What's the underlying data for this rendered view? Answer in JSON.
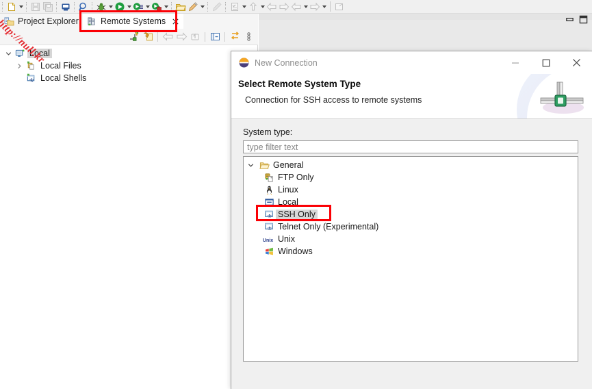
{
  "app_toolbar": {
    "items": [
      {
        "name": "new-file-button",
        "icon": "new-document-icon",
        "has_dropdown": true
      },
      {
        "name": "save-button",
        "icon": "save-icon",
        "has_dropdown": false
      },
      {
        "name": "save-all-button",
        "icon": "save-all-icon",
        "has_dropdown": false
      },
      {
        "name": "print-button",
        "icon": "print-icon",
        "has_dropdown": false
      },
      {
        "name": "search-button",
        "icon": "search-icon",
        "has_dropdown": false
      },
      {
        "name": "debug-button",
        "icon": "debug-bug-icon",
        "has_dropdown": true
      },
      {
        "name": "run-button",
        "icon": "run-play-icon",
        "has_dropdown": true
      },
      {
        "name": "run-external-tools-button",
        "icon": "external-tools-icon",
        "has_dropdown": true
      },
      {
        "name": "profile-button",
        "icon": "profile-icon",
        "has_dropdown": true
      },
      {
        "name": "open-resource-button",
        "icon": "open-folder-icon",
        "has_dropdown": false
      },
      {
        "name": "pencil-button",
        "icon": "pencil-icon",
        "has_dropdown": true
      },
      {
        "name": "edit-button",
        "icon": "grey-pencil-icon",
        "has_dropdown": false
      },
      {
        "name": "task-button",
        "icon": "checklist-icon",
        "has_dropdown": true
      },
      {
        "name": "next-annotation-button",
        "icon": "up-arrow-icon",
        "has_dropdown": true
      },
      {
        "name": "back-button",
        "icon": "back-arrow-icon",
        "has_dropdown": false
      },
      {
        "name": "forward-button",
        "icon": "forward-arrow-icon",
        "has_dropdown": false
      },
      {
        "name": "previous-edit-button",
        "icon": "left-arrow-icon",
        "has_dropdown": true
      },
      {
        "name": "next-edit-button",
        "icon": "right-arrow-icon",
        "has_dropdown": true
      },
      {
        "name": "new-window-button",
        "icon": "new-window-icon",
        "has_dropdown": false
      }
    ]
  },
  "tabs": [
    {
      "label": "Project Explorer",
      "icon": "project-explorer-icon",
      "active": false,
      "closable": false
    },
    {
      "label": "Remote Systems",
      "icon": "remote-systems-icon",
      "active": true,
      "closable": true
    }
  ],
  "view_window_buttons": [
    {
      "name": "minimize-view-button",
      "icon": "minimize-icon"
    },
    {
      "name": "maximize-view-button",
      "icon": "maximize-icon"
    }
  ],
  "view_toolbar": {
    "items": [
      {
        "name": "new-connection-toolbar-button",
        "icon": "new-connection-icon"
      },
      {
        "name": "refresh-button",
        "icon": "refresh-icon"
      },
      {
        "name": "back-nav-button",
        "icon": "back-arrow-icon"
      },
      {
        "name": "forward-nav-button",
        "icon": "forward-arrow-icon"
      },
      {
        "name": "go-up-button",
        "icon": "go-up-icon"
      },
      {
        "name": "collapse-all-button",
        "icon": "collapse-all-icon"
      },
      {
        "name": "link-with-editor-button",
        "icon": "link-editor-icon"
      },
      {
        "name": "view-menu-button",
        "icon": "view-menu-icon"
      }
    ]
  },
  "tree": {
    "items": [
      {
        "label": "Local",
        "icon": "local-system-icon",
        "indent": 0,
        "twisty": "expanded",
        "selected": true
      },
      {
        "label": "Local Files",
        "icon": "local-files-icon",
        "indent": 1,
        "twisty": "collapsed",
        "selected": false
      },
      {
        "label": "Local Shells",
        "icon": "local-shells-icon",
        "indent": 1,
        "twisty": "none",
        "selected": false
      }
    ]
  },
  "dialog": {
    "title": "New Connection",
    "title_icon": "eclipse-logo-icon",
    "window_buttons": [
      {
        "name": "dialog-minimize-button",
        "icon": "minimize-icon",
        "label": "—"
      },
      {
        "name": "dialog-maximize-button",
        "icon": "maximize-icon",
        "label": "□"
      },
      {
        "name": "dialog-close-button",
        "icon": "close-icon",
        "label": "✕"
      }
    ],
    "header_title": "Select Remote System Type",
    "header_subtitle": "Connection for SSH access to remote systems",
    "system_type_label": "System type:",
    "filter_placeholder": "type filter text",
    "filter_value": "",
    "type_tree": [
      {
        "label": "General",
        "icon": "folder-open-icon",
        "level": 0,
        "twisty": "expanded",
        "selected": false
      },
      {
        "label": "FTP Only",
        "icon": "ftp-icon",
        "level": 1,
        "twisty": "none",
        "selected": false
      },
      {
        "label": "Linux",
        "icon": "linux-penguin-icon",
        "level": 1,
        "twisty": "none",
        "selected": false
      },
      {
        "label": "Local",
        "icon": "local-icon",
        "level": 1,
        "twisty": "none",
        "selected": false
      },
      {
        "label": "SSH Only",
        "icon": "ssh-icon",
        "level": 1,
        "twisty": "none",
        "selected": true
      },
      {
        "label": "Telnet Only (Experimental)",
        "icon": "telnet-icon",
        "level": 1,
        "twisty": "none",
        "selected": false
      },
      {
        "label": "Unix",
        "icon": "unix-text-icon",
        "level": 1,
        "twisty": "none",
        "selected": false
      },
      {
        "label": "Windows",
        "icon": "windows-flag-icon",
        "level": 1,
        "twisty": "none",
        "selected": false
      }
    ]
  },
  "annotations": {
    "highlight_color": "#fb0005",
    "boxes": [
      {
        "name": "highlight-remote-systems-tab",
        "target": "Remote Systems"
      },
      {
        "name": "highlight-ssh-only-item",
        "target": "SSH Only"
      }
    ]
  },
  "watermark": {
    "text": "http://null.kr",
    "color": "#e4282e"
  }
}
